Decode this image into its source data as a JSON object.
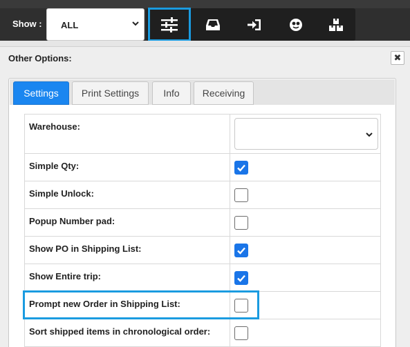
{
  "toolbar": {
    "show_label": "Show :",
    "show_value": "ALL",
    "icons": [
      "sliders-icon",
      "inbox-tray-icon",
      "sign-in-icon",
      "face-icon",
      "boxes-icon"
    ]
  },
  "panel": {
    "title": "Other Options:",
    "close_symbol": "✖"
  },
  "tabs": [
    {
      "label": "Settings",
      "active": true
    },
    {
      "label": "Print Settings",
      "active": false
    },
    {
      "label": "Info",
      "active": false
    },
    {
      "label": "Receiving",
      "active": false
    }
  ],
  "settings": {
    "warehouse_label": "Warehouse:",
    "warehouse_value": "",
    "rows": [
      {
        "label": "Simple Qty:",
        "checked": true
      },
      {
        "label": "Simple Unlock:",
        "checked": false
      },
      {
        "label": "Popup Number pad:",
        "checked": false
      },
      {
        "label": "Show PO in Shipping List:",
        "checked": true
      },
      {
        "label": "Show Entire trip:",
        "checked": true
      },
      {
        "label": "Prompt new Order in Shipping List:",
        "checked": false
      },
      {
        "label": "Sort shipped items in chronological order:",
        "checked": false
      }
    ]
  },
  "colors": {
    "accent": "#1a86f0",
    "highlight": "#1a9be0",
    "toolbar": "#2f2f2f"
  }
}
